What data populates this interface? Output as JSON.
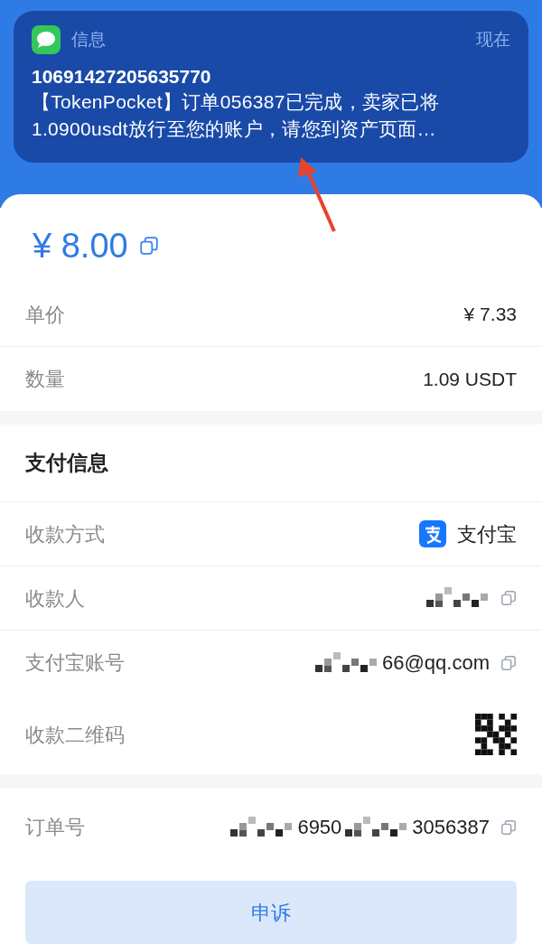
{
  "notification": {
    "app": "信息",
    "time": "现在",
    "sender": "10691427205635770",
    "body": "【TokenPocket】订单056387已完成，卖家已将1.0900usdt放行至您的账户，请您到资产页面…"
  },
  "amount": {
    "value": "¥ 8.00",
    "copyable": true
  },
  "order_rows": [
    {
      "label": "单价",
      "kind": "text",
      "value": "¥ 7.33"
    },
    {
      "label": "数量",
      "kind": "text",
      "value": "1.09 USDT"
    }
  ],
  "payment": {
    "title": "支付信息",
    "rows": [
      {
        "label": "收款方式",
        "kind": "alipay",
        "value": "支付宝"
      },
      {
        "label": "收款人",
        "kind": "masked",
        "parts": [
          {
            "kind": "mosaic"
          }
        ],
        "copyable": true
      },
      {
        "label": "支付宝账号",
        "kind": "masked",
        "parts": [
          {
            "kind": "mosaic"
          },
          {
            "kind": "text",
            "text": "66@qq.com"
          }
        ],
        "copyable": true
      },
      {
        "label": "收款二维码",
        "kind": "qr"
      }
    ]
  },
  "order_number": {
    "label": "订单号",
    "kind": "masked",
    "parts": [
      {
        "kind": "mosaic"
      },
      {
        "kind": "text",
        "text": "6950"
      },
      {
        "kind": "mosaic"
      },
      {
        "kind": "text",
        "text": "3056387"
      }
    ],
    "copyable": true
  },
  "appeal_button": "申诉"
}
